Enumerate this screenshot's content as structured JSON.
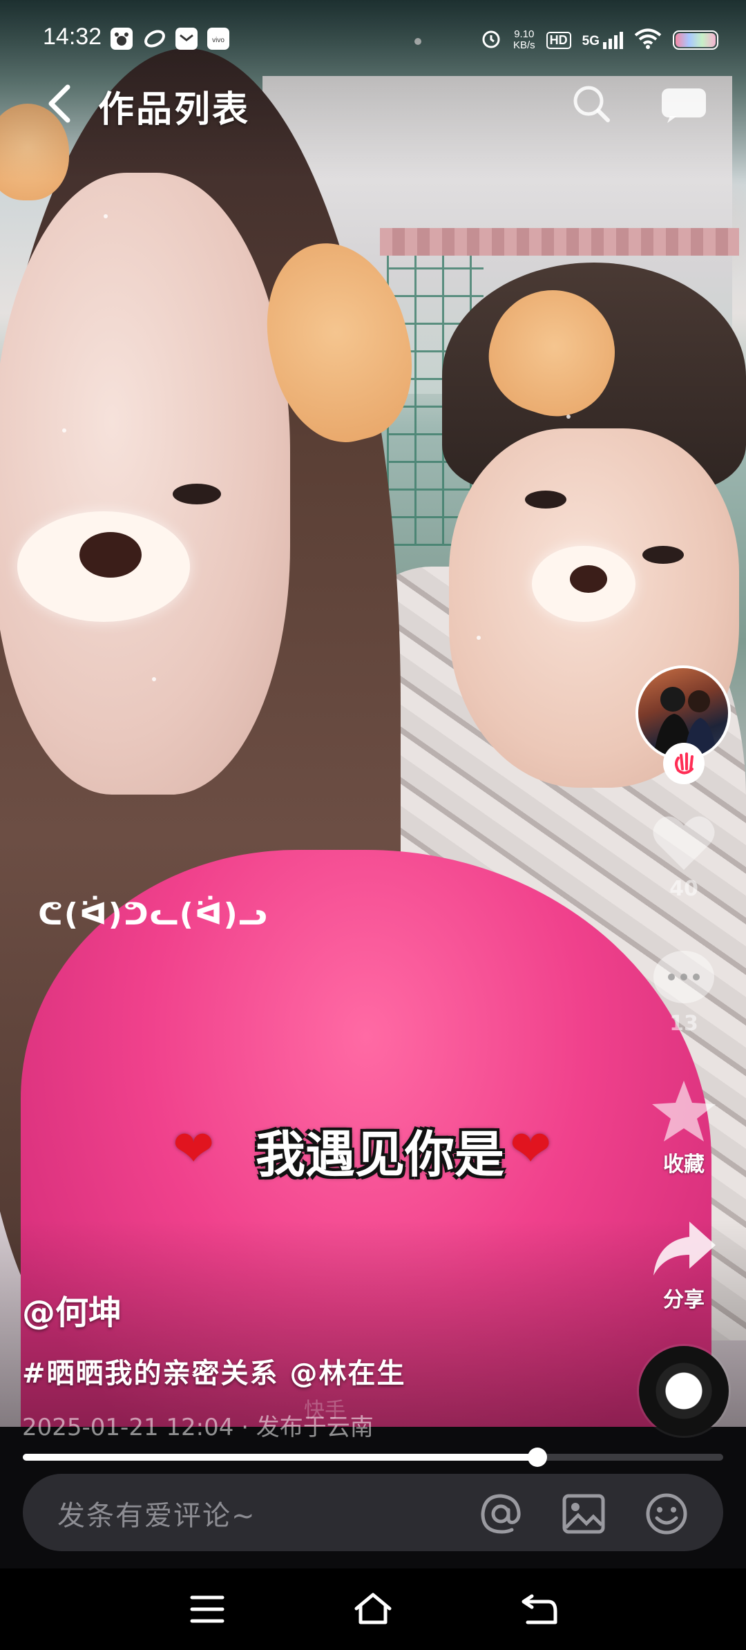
{
  "status_bar": {
    "time": "14:32",
    "net_speed_value": "9.10",
    "net_speed_unit": "KB/s",
    "hd": "HD",
    "network": "5G",
    "icons": [
      "baidu-app-icon",
      "swirl-app-icon",
      "message-app-icon",
      "vivo-app-icon",
      "alarm-icon",
      "signal-icon",
      "wifi-icon",
      "battery-icon"
    ]
  },
  "header": {
    "title": "作品列表",
    "icons": [
      "back-icon",
      "search-icon",
      "chat-icon"
    ]
  },
  "video": {
    "sticker_text": "ᕦ(ᐛ)ᕤᓚ(ᐛ)ᓗ",
    "overlay_text": "我遇见你是",
    "overlay_heart": "❤",
    "watermark": "快手"
  },
  "rail": {
    "like_count": "40",
    "comment_count": "13",
    "collect_label": "收藏",
    "share_label": "分享"
  },
  "post": {
    "author": "@何坤",
    "description": "#晒晒我的亲密关系 @林在生",
    "meta": "2025-01-21 12:04 · 发布于云南"
  },
  "progress": {
    "fraction": 0.735
  },
  "comment_bar": {
    "placeholder": "发条有爱评论~",
    "icons": [
      "at-icon",
      "image-icon",
      "emoji-icon"
    ]
  },
  "nav_bar": {
    "icons": [
      "menu-icon",
      "home-icon",
      "back-nav-icon"
    ]
  },
  "colors": {
    "accent_heart": "#e1141f",
    "comment_bar_bg": "#2c2c31",
    "background": "#0b0b0d"
  }
}
